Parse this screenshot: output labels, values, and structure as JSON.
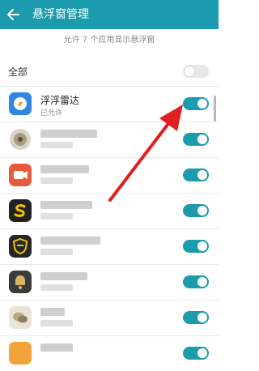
{
  "header": {
    "title": "悬浮窗管理",
    "back_icon": "arrow-left-icon",
    "background": "#1b9bad"
  },
  "subtitle": "允许 7 个应用显示悬浮窗",
  "all_toggle": {
    "label": "全部",
    "on": false
  },
  "apps": [
    {
      "name": "浮浮雷达",
      "status": "已允许",
      "icon": "compass-icon",
      "blurred": false,
      "on": true
    },
    {
      "name": "",
      "status": "",
      "icon": "joystick-icon",
      "blurred": true,
      "on": true
    },
    {
      "name": "",
      "status": "",
      "icon": "video-icon",
      "blurred": true,
      "on": true
    },
    {
      "name": "",
      "status": "",
      "icon": "s-logo-icon",
      "blurred": true,
      "on": true
    },
    {
      "name": "",
      "status": "",
      "icon": "shield-icon",
      "blurred": true,
      "on": true
    },
    {
      "name": "",
      "status": "",
      "icon": "bell-icon",
      "blurred": true,
      "on": true
    },
    {
      "name": "",
      "status": "",
      "icon": "chat-icon",
      "blurred": true,
      "on": true
    },
    {
      "name": "",
      "status": "",
      "icon": "app-icon",
      "blurred": true,
      "on": true
    }
  ],
  "colors": {
    "accent": "#1b9bad",
    "arrow": "#e02020"
  }
}
